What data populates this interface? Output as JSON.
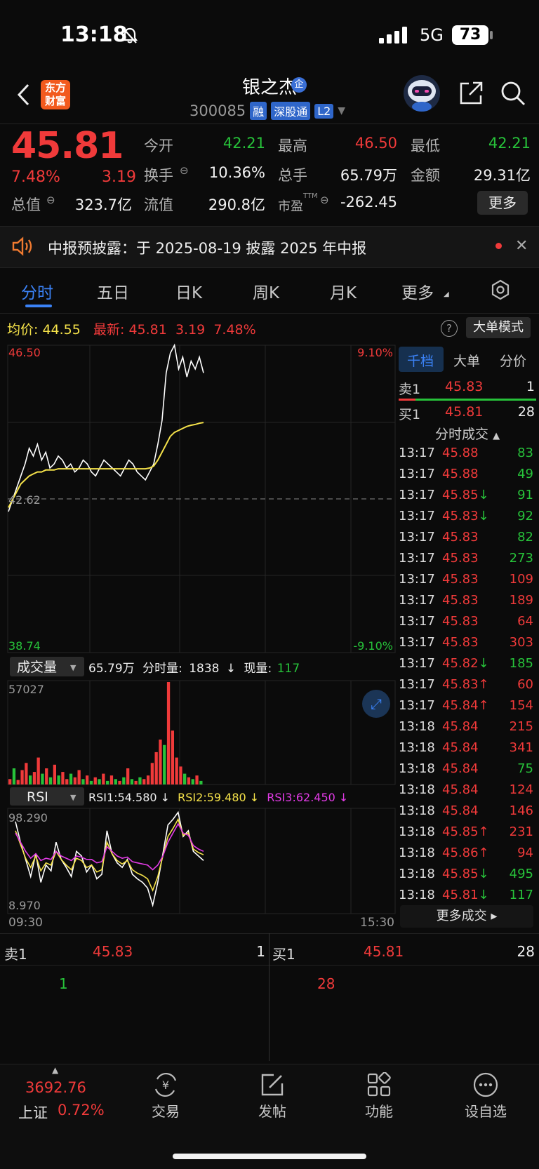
{
  "status": {
    "time": "13:18",
    "network": "5G",
    "battery": "73"
  },
  "header": {
    "logo_line1": "东方",
    "logo_line2": "财富",
    "name": "银之杰",
    "name_badge": "企",
    "code": "300085",
    "tags": [
      "融",
      "深股通",
      "L2"
    ]
  },
  "quote": {
    "price": "45.81",
    "pct": "7.48%",
    "chg": "3.19",
    "open_label": "今开",
    "open": "42.21",
    "high_label": "最高",
    "high": "46.50",
    "low_label": "最低",
    "low": "42.21",
    "turnover_label": "换手",
    "turnover": "10.36%",
    "volume_label": "总手",
    "volume": "65.79万",
    "amount_label": "金额",
    "amount": "29.31亿",
    "mktcap_label": "总值",
    "mktcap": "323.7亿",
    "float_label": "流值",
    "float": "290.8亿",
    "pe_label": "市盈",
    "pe_sup": "TTM",
    "pe": "-262.45",
    "more": "更多"
  },
  "notice": {
    "text": "中报预披露：于 2025-08-19 披露 2025 年中报"
  },
  "tabs": [
    "分时",
    "五日",
    "日K",
    "周K",
    "月K",
    "更多"
  ],
  "chart_info": {
    "avg_label": "均价:",
    "avg": "44.55",
    "latest_label": "最新:",
    "latest": "45.81",
    "latest_chg": "3.19",
    "latest_pct": "7.48%",
    "mode_btn": "大单模式"
  },
  "chart_data": [
    {
      "type": "line",
      "y_axis_left": [
        "46.50",
        "42.62",
        "38.74"
      ],
      "y_axis_right": [
        "9.10%",
        "-9.10%"
      ],
      "prev_close": 42.62,
      "ylim": [
        38.74,
        46.5
      ],
      "series": [
        {
          "values": [
            42.3,
            42.6,
            42.9,
            43.2,
            43.5,
            43.9,
            43.7,
            44.0,
            43.6,
            43.8,
            43.4,
            43.5,
            43.7,
            43.6,
            43.4,
            43.5,
            43.3,
            43.4,
            43.6,
            43.5,
            43.3,
            43.2,
            43.4,
            43.6,
            43.5,
            43.4,
            43.3,
            43.2,
            43.4,
            43.6,
            43.5,
            43.3,
            43.2,
            43.1,
            43.3,
            43.5,
            44.0,
            44.6,
            45.8,
            46.3,
            46.5,
            45.9,
            46.2,
            45.7,
            46.1,
            45.9,
            46.2,
            45.8
          ]
        },
        {
          "values": [
            42.4,
            42.6,
            42.8,
            43.0,
            43.1,
            43.2,
            43.25,
            43.3,
            43.3,
            43.35,
            43.35,
            43.35,
            43.38,
            43.38,
            43.38,
            43.38,
            43.38,
            43.38,
            43.38,
            43.38,
            43.38,
            43.38,
            43.38,
            43.38,
            43.38,
            43.38,
            43.38,
            43.38,
            43.38,
            43.38,
            43.38,
            43.38,
            43.38,
            43.38,
            43.4,
            43.45,
            43.6,
            43.8,
            44.0,
            44.2,
            44.3,
            44.35,
            44.4,
            44.45,
            44.48,
            44.5,
            44.53,
            44.55
          ]
        }
      ]
    },
    {
      "type": "bar",
      "ylim": [
        0,
        57027
      ],
      "y_axis_top": "57027",
      "values": [
        3000,
        9000,
        2500,
        8000,
        12000,
        5000,
        7000,
        15000,
        6000,
        9000,
        4000,
        11000,
        5000,
        7000,
        3000,
        6000,
        4000,
        8000,
        3000,
        5000,
        2000,
        4000,
        3000,
        6000,
        2000,
        5000,
        3000,
        2000,
        4000,
        9000,
        3000,
        2000,
        4000,
        3000,
        5000,
        12000,
        18000,
        25000,
        22000,
        57027,
        30000,
        15000,
        10000,
        6000,
        4000,
        3000,
        5000,
        2000
      ],
      "colors": [
        "red",
        "green",
        "red",
        "red",
        "red",
        "green",
        "red",
        "red",
        "green",
        "red",
        "green",
        "red",
        "green",
        "red",
        "red",
        "green",
        "red",
        "red",
        "green",
        "red",
        "green",
        "red",
        "green",
        "red",
        "green",
        "red",
        "green",
        "red",
        "green",
        "red",
        "green",
        "red",
        "green",
        "red",
        "red",
        "red",
        "red",
        "red",
        "green",
        "red",
        "red",
        "red",
        "red",
        "green",
        "red",
        "green",
        "red",
        "green"
      ]
    },
    {
      "type": "line",
      "y_axis_top": "98.290",
      "y_axis_bottom": "8.970",
      "ylim": [
        8.97,
        98.29
      ],
      "series": [
        {
          "name": "RSI1",
          "values": [
            88,
            70,
            55,
            40,
            60,
            35,
            50,
            45,
            70,
            55,
            48,
            40,
            62,
            58,
            44,
            50,
            38,
            42,
            80,
            60,
            52,
            48,
            55,
            42,
            38,
            35,
            30,
            15,
            35,
            60,
            85,
            90,
            96,
            75,
            80,
            62,
            58,
            54
          ]
        },
        {
          "name": "RSI2",
          "values": [
            80,
            68,
            56,
            48,
            58,
            45,
            52,
            50,
            62,
            55,
            50,
            46,
            56,
            54,
            48,
            50,
            44,
            46,
            70,
            60,
            54,
            51,
            54,
            46,
            43,
            41,
            38,
            28,
            40,
            58,
            75,
            82,
            90,
            76,
            78,
            64,
            61,
            59
          ]
        },
        {
          "name": "RSI3",
          "values": [
            78,
            70,
            62,
            56,
            60,
            54,
            56,
            55,
            62,
            58,
            56,
            54,
            58,
            57,
            55,
            55,
            52,
            53,
            66,
            62,
            58,
            56,
            57,
            53,
            52,
            51,
            50,
            46,
            50,
            58,
            70,
            78,
            86,
            78,
            76,
            67,
            64,
            62
          ]
        }
      ]
    }
  ],
  "chart_times": {
    "start": "09:30",
    "end": "15:30"
  },
  "volume_panel": {
    "label": "成交量",
    "total": "65.79万",
    "min_label": "分时量:",
    "min_vol": "1838",
    "now_label": "现量:",
    "now": "117"
  },
  "rsi_panel": {
    "label": "RSI",
    "rsi1": "RSI1:54.580 ↓",
    "rsi2": "RSI2:59.480 ↓",
    "rsi3": "RSI3:62.450 ↓"
  },
  "side": {
    "tabs": [
      "千档",
      "大单",
      "分价"
    ],
    "sell1_label": "卖1",
    "sell1_price": "45.83",
    "sell1_qty": "1",
    "buy1_label": "买1",
    "buy1_price": "45.81",
    "buy1_qty": "28",
    "trades_title": "分时成交",
    "trades": [
      {
        "t": "13:17",
        "p": "45.88",
        "a": "",
        "v": "83",
        "vc": "green"
      },
      {
        "t": "13:17",
        "p": "45.88",
        "a": "",
        "v": "49",
        "vc": "green"
      },
      {
        "t": "13:17",
        "p": "45.85",
        "a": "↓",
        "v": "91",
        "vc": "green"
      },
      {
        "t": "13:17",
        "p": "45.83",
        "a": "↓",
        "v": "92",
        "vc": "green"
      },
      {
        "t": "13:17",
        "p": "45.83",
        "a": "",
        "v": "82",
        "vc": "green"
      },
      {
        "t": "13:17",
        "p": "45.83",
        "a": "",
        "v": "273",
        "vc": "green"
      },
      {
        "t": "13:17",
        "p": "45.83",
        "a": "",
        "v": "109",
        "vc": "red"
      },
      {
        "t": "13:17",
        "p": "45.83",
        "a": "",
        "v": "189",
        "vc": "red"
      },
      {
        "t": "13:17",
        "p": "45.83",
        "a": "",
        "v": "64",
        "vc": "red"
      },
      {
        "t": "13:17",
        "p": "45.83",
        "a": "",
        "v": "303",
        "vc": "red"
      },
      {
        "t": "13:17",
        "p": "45.82",
        "a": "↓",
        "v": "185",
        "vc": "green"
      },
      {
        "t": "13:17",
        "p": "45.83",
        "a": "↑",
        "v": "60",
        "vc": "red"
      },
      {
        "t": "13:17",
        "p": "45.84",
        "a": "↑",
        "v": "154",
        "vc": "red"
      },
      {
        "t": "13:18",
        "p": "45.84",
        "a": "",
        "v": "215",
        "vc": "red"
      },
      {
        "t": "13:18",
        "p": "45.84",
        "a": "",
        "v": "341",
        "vc": "red"
      },
      {
        "t": "13:18",
        "p": "45.84",
        "a": "",
        "v": "75",
        "vc": "green"
      },
      {
        "t": "13:18",
        "p": "45.84",
        "a": "",
        "v": "124",
        "vc": "red"
      },
      {
        "t": "13:18",
        "p": "45.84",
        "a": "",
        "v": "146",
        "vc": "red"
      },
      {
        "t": "13:18",
        "p": "45.85",
        "a": "↑",
        "v": "231",
        "vc": "red"
      },
      {
        "t": "13:18",
        "p": "45.86",
        "a": "↑",
        "v": "94",
        "vc": "red"
      },
      {
        "t": "13:18",
        "p": "45.85",
        "a": "↓",
        "v": "495",
        "vc": "green"
      },
      {
        "t": "13:18",
        "p": "45.81",
        "a": "↓",
        "v": "117",
        "vc": "green"
      }
    ],
    "more_trades": "更多成交 ▸"
  },
  "book": {
    "sell_label": "卖1",
    "sell_price": "45.83",
    "sell_qty": "1",
    "sell_sub": "1",
    "buy_label": "买1",
    "buy_price": "45.81",
    "buy_qty": "28",
    "buy_sub": "28"
  },
  "nav": {
    "index_value": "3692.76",
    "index_name": "上证",
    "index_pct": "0.72%",
    "items": [
      "交易",
      "发帖",
      "功能",
      "设自选"
    ]
  }
}
